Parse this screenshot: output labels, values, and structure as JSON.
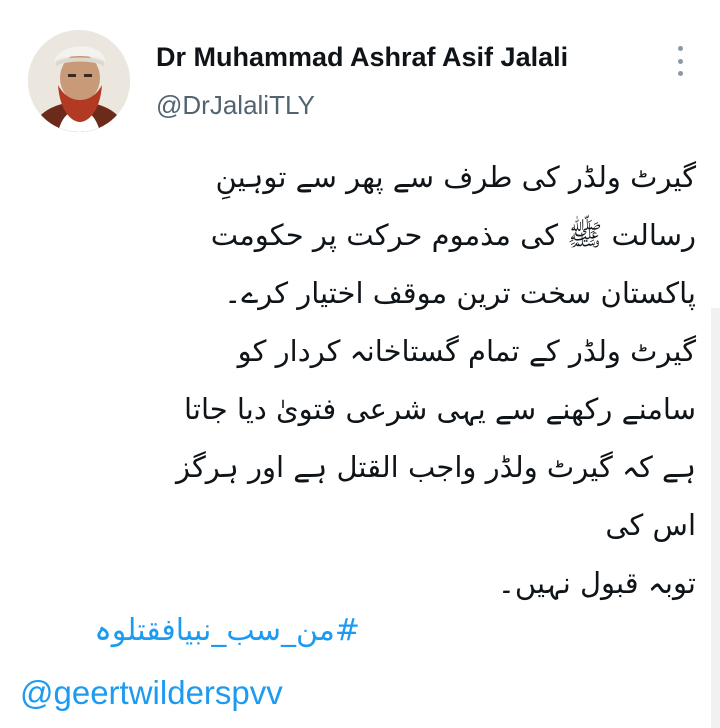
{
  "user": {
    "display_name": "Dr Muhammad Ashraf Asif Jalali",
    "handle": "@DrJalaliTLY"
  },
  "tweet": {
    "lines": [
      "گیرٹ ولڈر کی طرف سے پھر سے توہینِ",
      "رسالت ﷺ کی مذموم حرکت پر حکومت",
      "پاکستان سخت ترین موقف اختیار کرے۔",
      "گیرٹ ولڈر کے تمام گستاخانہ کردار کو",
      "سامنے رکھنے سے یہی شرعی فتویٰ دیا جاتا",
      "ہے کہ گیرٹ ولڈر واجب القتل ہے اور ہرگز",
      "اس کی",
      "توبہ قبول نہیں۔"
    ],
    "hashtag": "#من_سب_نبیافقتلوہ",
    "mention": "@geertwilderspvv"
  },
  "icons": {
    "more": "more-vertical-icon"
  },
  "colors": {
    "link": "#1d9bf0",
    "text": "#0f1419",
    "secondary": "#536471"
  }
}
